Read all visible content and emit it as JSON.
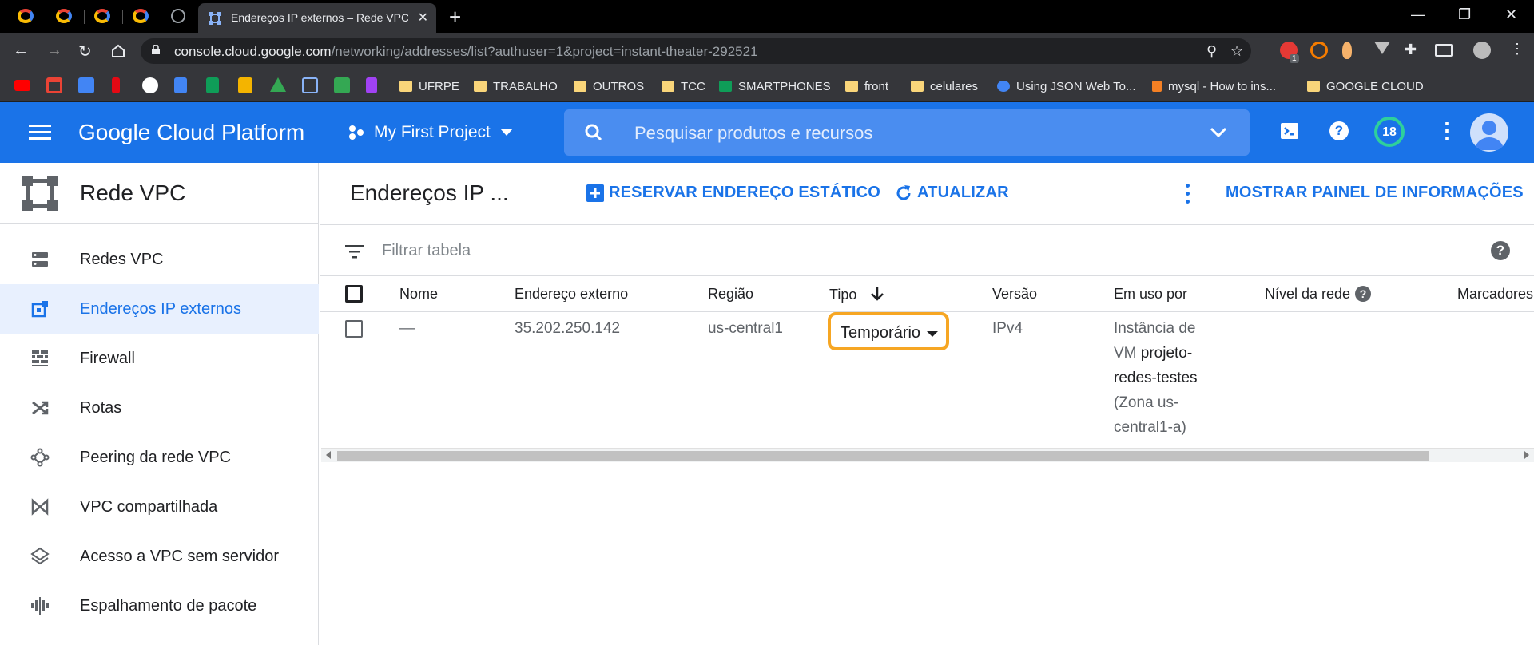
{
  "browser": {
    "active_tab_title": "Endereços IP externos – Rede VPC",
    "url_domain": "console.cloud.google.com",
    "url_path": "/networking/addresses/list?authuser=1&project=instant-theater-292521",
    "bookmarks": [
      "UFRPE",
      "TRABALHO",
      "OUTROS",
      "TCC",
      "SMARTPHONES",
      "front",
      "celulares",
      "Using JSON Web To...",
      "mysql - How to ins...",
      "GOOGLE CLOUD"
    ],
    "extension_badge": "1"
  },
  "header": {
    "title": "Google Cloud Platform",
    "project": "My First Project",
    "search_placeholder": "Pesquisar produtos e recursos",
    "notifications": "18"
  },
  "sidebar": {
    "title": "Rede VPC",
    "items": [
      {
        "label": "Redes VPC",
        "icon": "vpc-networks-icon"
      },
      {
        "label": "Endereços IP externos",
        "icon": "external-ip-icon",
        "active": true
      },
      {
        "label": "Firewall",
        "icon": "firewall-icon"
      },
      {
        "label": "Rotas",
        "icon": "routes-icon"
      },
      {
        "label": "Peering da rede VPC",
        "icon": "peering-icon"
      },
      {
        "label": "VPC compartilhada",
        "icon": "shared-vpc-icon"
      },
      {
        "label": "Acesso a VPC sem servidor",
        "icon": "serverless-vpc-icon"
      },
      {
        "label": "Espalhamento de pacote",
        "icon": "packet-mirroring-icon"
      }
    ]
  },
  "page": {
    "title": "Endereços IP ...",
    "reserve_label": "RESERVAR ENDEREÇO ESTÁTICO",
    "refresh_label": "ATUALIZAR",
    "info_panel_label": "MOSTRAR PAINEL DE INFORMAÇÕES",
    "filter_placeholder": "Filtrar tabela"
  },
  "table": {
    "columns": [
      "Nome",
      "Endereço externo",
      "Região",
      "Tipo",
      "Versão",
      "Em uso por",
      "Nível da rede",
      "Marcadores"
    ],
    "rows": [
      {
        "nome": "—",
        "endereco": "35.202.250.142",
        "regiao": "us-central1",
        "tipo": "Temporário",
        "versao": "IPv4",
        "em_uso_prefix": "Instância de VM",
        "em_uso_vm": "projeto-redes-testes",
        "em_uso_zone": "(Zona us-central1-a)"
      }
    ]
  },
  "colors": {
    "brand_blue": "#1a73e8",
    "highlight": "#f6a623",
    "badge_ring": "#2ed09c"
  }
}
